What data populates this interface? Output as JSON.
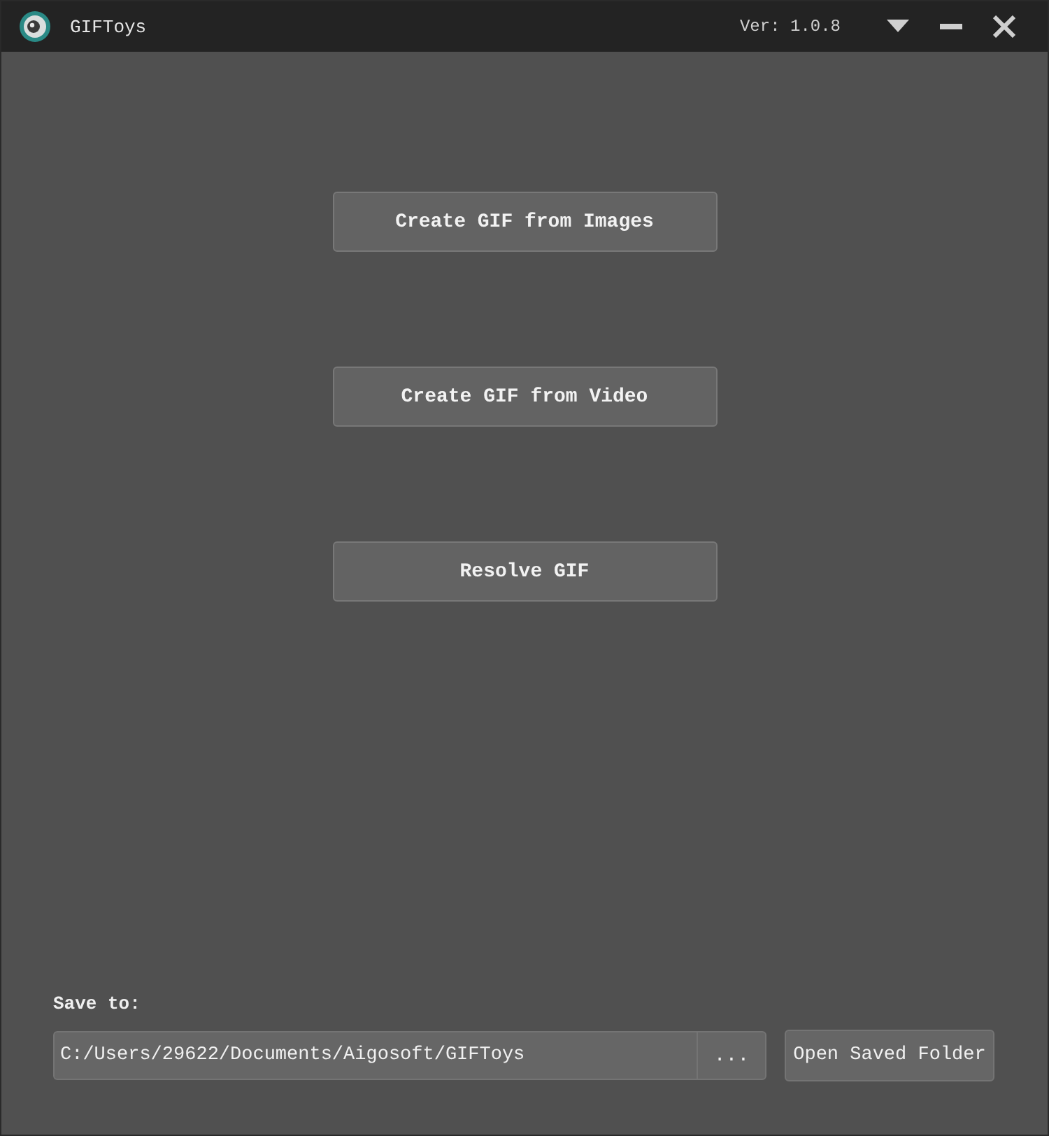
{
  "window": {
    "title": "GIFToys",
    "version": "Ver: 1.0.8"
  },
  "actions": [
    {
      "label": "Create GIF from Images"
    },
    {
      "label": "Create GIF from Video"
    },
    {
      "label": "Resolve GIF"
    }
  ],
  "save": {
    "label": "Save to:",
    "path": "C:/Users/29622/Documents/Aigosoft/GIFToys",
    "browse": "...",
    "open_folder": "Open Saved Folder"
  }
}
